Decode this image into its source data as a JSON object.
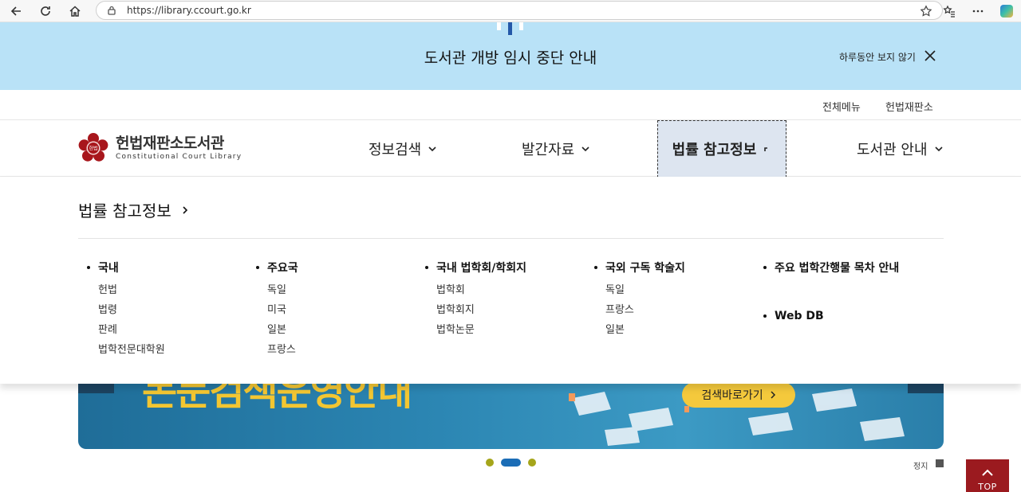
{
  "browser": {
    "url": "https://library.ccourt.go.kr"
  },
  "notice": {
    "title": "도서관 개방 임시 중단 안내",
    "dismiss_label": "하루동안 보지 않기"
  },
  "utility": {
    "all_menu": "전체메뉴",
    "court_link": "헌법재판소"
  },
  "logo": {
    "ko": "헌법재판소도서관",
    "en": "Constitutional Court Library",
    "emblem_text": "헌법"
  },
  "gnb": {
    "items": [
      {
        "label": "정보검색"
      },
      {
        "label": "발간자료"
      },
      {
        "label": "법률 참고정보"
      },
      {
        "label": "도서관 안내"
      }
    ]
  },
  "mega_menu": {
    "title": "법률 참고정보",
    "columns": [
      {
        "heading": "국내",
        "links": [
          "헌법",
          "법령",
          "판례",
          "법학전문대학원"
        ]
      },
      {
        "heading": "주요국",
        "links": [
          "독일",
          "미국",
          "일본",
          "프랑스"
        ]
      },
      {
        "heading": "국내 법학회/학회지",
        "links": [
          "법학회",
          "법학회지",
          "법학논문"
        ]
      },
      {
        "heading": "국외 구독 학술지",
        "links": [
          "독일",
          "프랑스",
          "일본"
        ]
      },
      {
        "heading": "주요 법학간행물 목차 안내",
        "heading2": "Web DB",
        "links": []
      }
    ]
  },
  "slide": {
    "headline": "논문검색운영안내",
    "cta_label": "검색바로가기",
    "active_index": 1,
    "total": 3
  },
  "controls": {
    "stop_label": "정지",
    "top_label": "TOP"
  },
  "colors": {
    "notice_bg": "#b9e2f7",
    "brand_red": "#9b1a1f",
    "active_menu_bg": "#dde5f0",
    "pager_active": "#1b6db6",
    "pager_dot": "#a5a51a",
    "cta_yellow": "#f4c93c"
  }
}
